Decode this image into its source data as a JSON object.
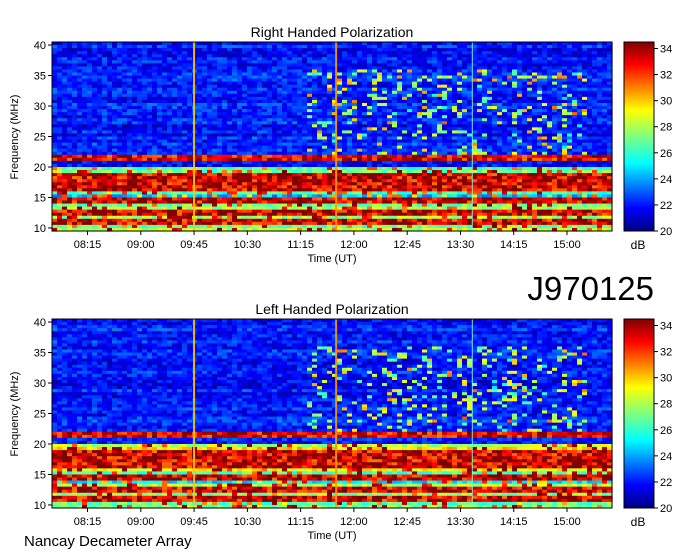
{
  "figure": {
    "id_label": "J970125",
    "footer": "Nancay Decameter Array"
  },
  "chart_data": [
    {
      "type": "heatmap",
      "title": "Right Handed Polarization",
      "xlabel": "Time (UT)",
      "ylabel": "Frequency (MHz)",
      "x_ticks": [
        "08:15",
        "09:00",
        "09:45",
        "10:30",
        "11:15",
        "12:00",
        "12:45",
        "13:30",
        "14:15",
        "15:00"
      ],
      "x_range": [
        "07:45",
        "15:38"
      ],
      "y_ticks": [
        10,
        15,
        20,
        25,
        30,
        35,
        40
      ],
      "y_range": [
        9.5,
        40.5
      ],
      "colorbar": {
        "label": "dB",
        "ticks": [
          20,
          22,
          24,
          26,
          28,
          30,
          32,
          34
        ],
        "range": [
          20,
          34.5
        ]
      },
      "bright_vertical_lines_ut": [
        "09:45",
        "11:45",
        "13:40"
      ],
      "strong_bands_mhz": [
        11,
        12.5,
        14.5,
        16.5,
        17.5,
        18.5,
        21.5
      ]
    },
    {
      "type": "heatmap",
      "title": "Left Handed Polarization",
      "xlabel": "Time (UT)",
      "ylabel": "Frequency (MHz)",
      "x_ticks": [
        "08:15",
        "09:00",
        "09:45",
        "10:30",
        "11:15",
        "12:00",
        "12:45",
        "13:30",
        "14:15",
        "15:00"
      ],
      "x_range": [
        "07:45",
        "15:38"
      ],
      "y_ticks": [
        10,
        15,
        20,
        25,
        30,
        35,
        40
      ],
      "y_range": [
        9.5,
        40.5
      ],
      "colorbar": {
        "label": "dB",
        "ticks": [
          20,
          22,
          24,
          26,
          28,
          30,
          32,
          34
        ],
        "range": [
          20,
          34.5
        ]
      },
      "bright_vertical_lines_ut": [
        "09:45",
        "11:45",
        "13:40"
      ],
      "strong_bands_mhz": [
        11,
        12.5,
        14.5,
        16.5,
        17.5,
        18.5,
        21.5
      ]
    }
  ]
}
